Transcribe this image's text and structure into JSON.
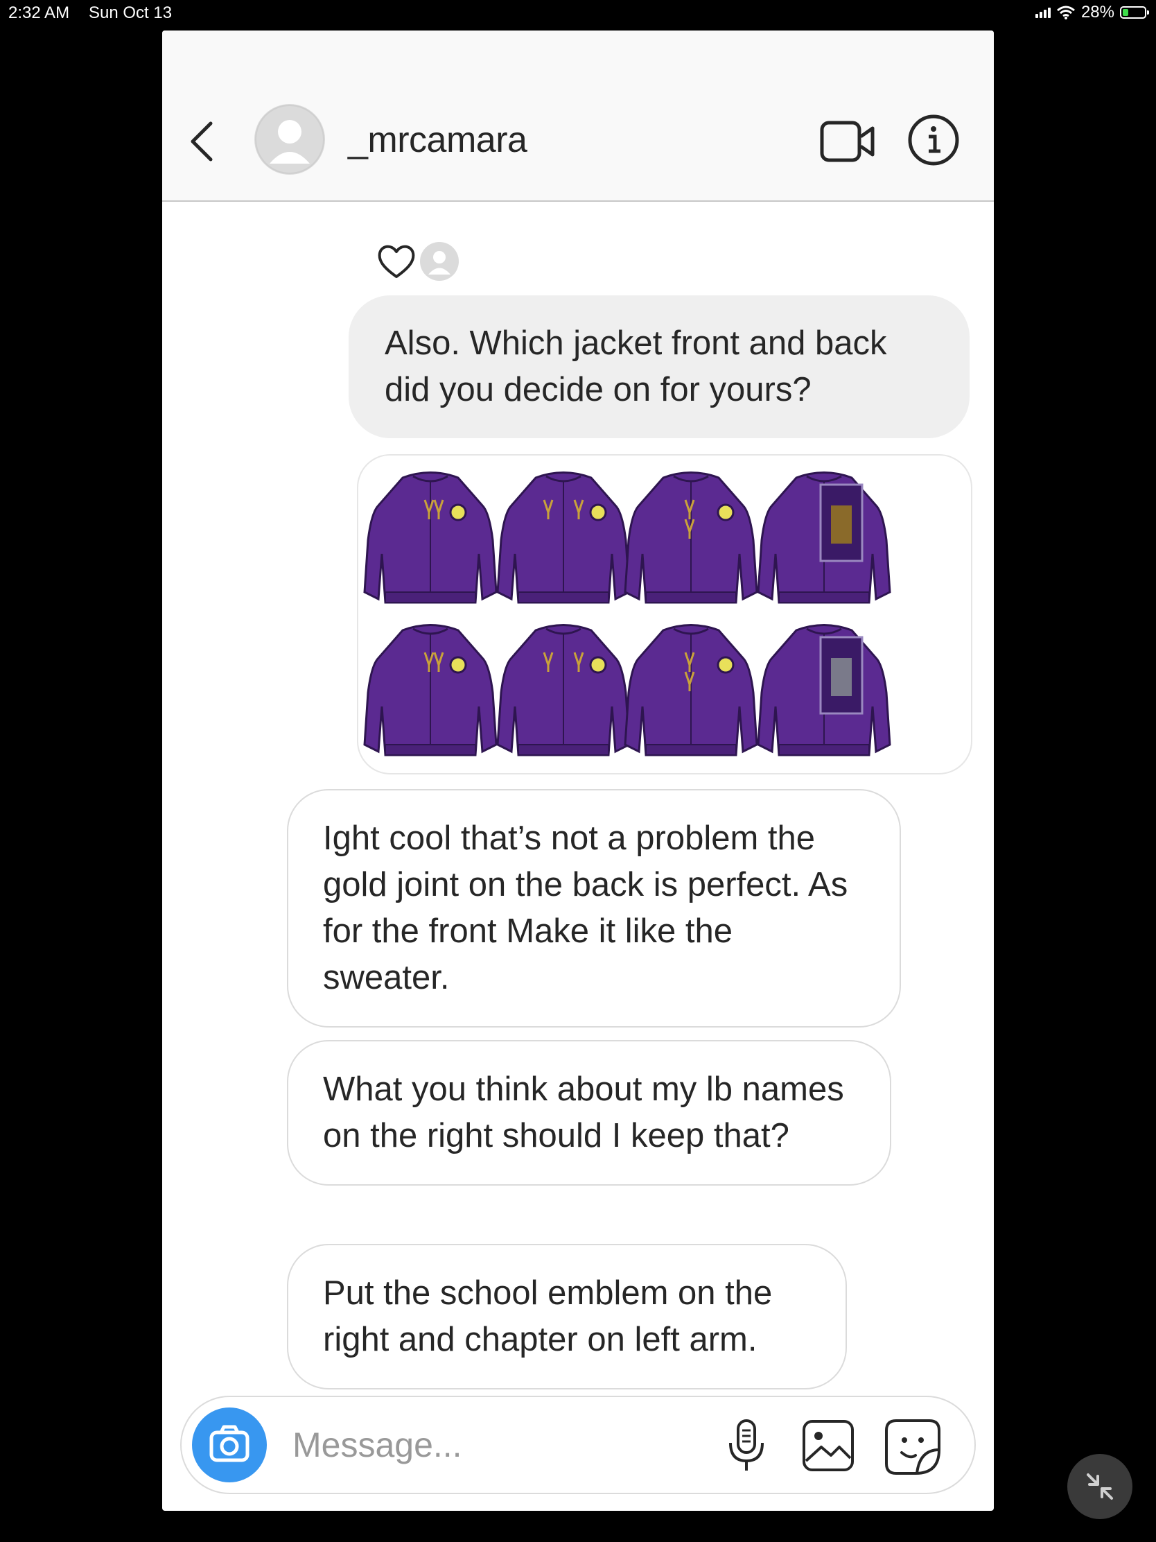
{
  "status_bar": {
    "time": "2:32 AM",
    "date": "Sun Oct 13",
    "battery": "28%",
    "battery_level": 0.28
  },
  "header": {
    "username": "_mrcamara"
  },
  "messages": [
    {
      "from": "me",
      "text": "Also. Which jacket front and back did you decide on for yours?"
    },
    {
      "from": "them",
      "text": "Ight cool that’s not a problem the gold joint on the back is perfect. As for the front Make it like the sweater."
    },
    {
      "from": "them",
      "text": "What you think about my lb names on the right should I keep that?"
    },
    {
      "from": "them",
      "text": "Put the school emblem on the right and chapter on left arm."
    }
  ],
  "composer": {
    "placeholder": "Message..."
  },
  "colors": {
    "accent": "#3897f0",
    "jacket_purple": "#5b2a91",
    "emblem_gold": "#c9a23b"
  },
  "icons": [
    "back-chevron-icon",
    "video-call-icon",
    "info-icon",
    "heart-icon",
    "camera-icon",
    "microphone-icon",
    "gallery-icon",
    "sticker-icon",
    "minimize-arrows-icon"
  ]
}
